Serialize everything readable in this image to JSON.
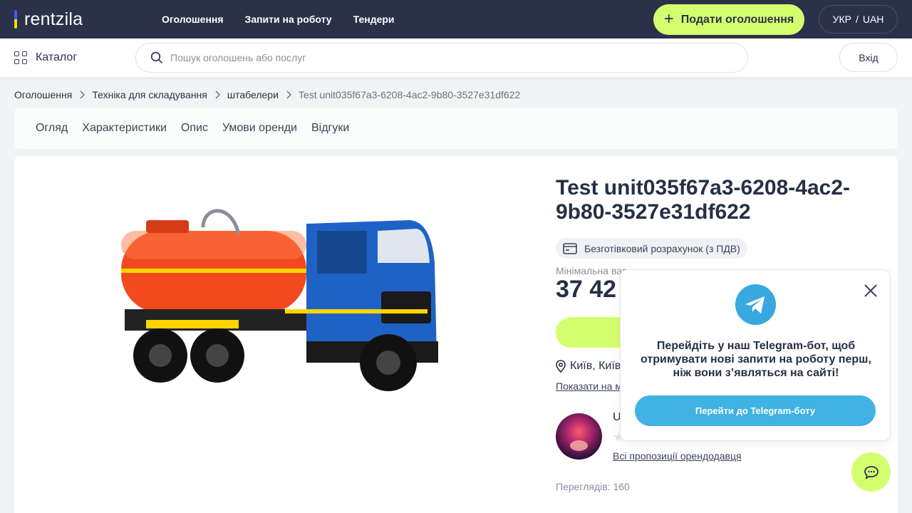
{
  "header": {
    "logo_text": "rentzila",
    "nav": [
      "Оголошення",
      "Запити на роботу",
      "Тендери"
    ],
    "post_button": "Подати оголошення",
    "lang": "УКР",
    "currency": "UAH",
    "lang_sep": "/"
  },
  "subbar": {
    "catalog_label": "Каталог",
    "search_placeholder": "Пошук оголошень або послуг",
    "login_label": "Вхід"
  },
  "breadcrumb": [
    "Оголошення",
    "Техніка для складування",
    "штабелери",
    "Test unit035f67a3-6208-4ac2-9b80-3527e31df622"
  ],
  "tabs": [
    "Огляд",
    "Характеристики",
    "Опис",
    "Умови оренди",
    "Відгуки"
  ],
  "unit": {
    "title": "Test unit035f67a3-6208-4ac2-9b80-3527e31df622",
    "payment": "Безготівковий розрахунок (з ПДВ)",
    "min_price_label": "Мінімальна вар",
    "price": "37 42",
    "location": "Київ, Київс",
    "map_link": "Показати на м",
    "owner_initial": "U",
    "rating_stars": "★★★★★",
    "all_offers": "Всі пропозиції орендодавця",
    "views": "Переглядів: 160"
  },
  "telegram": {
    "text": "Перейдіть у наш Telegram-бот, щоб отримувати нові запити на роботу перш, ніж вони з’являться на сайті!",
    "button": "Перейти до Telegram-боту"
  },
  "colors": {
    "header_bg": "#2b3149",
    "accent": "#d3ff6f",
    "telegram": "#40b2e3"
  }
}
